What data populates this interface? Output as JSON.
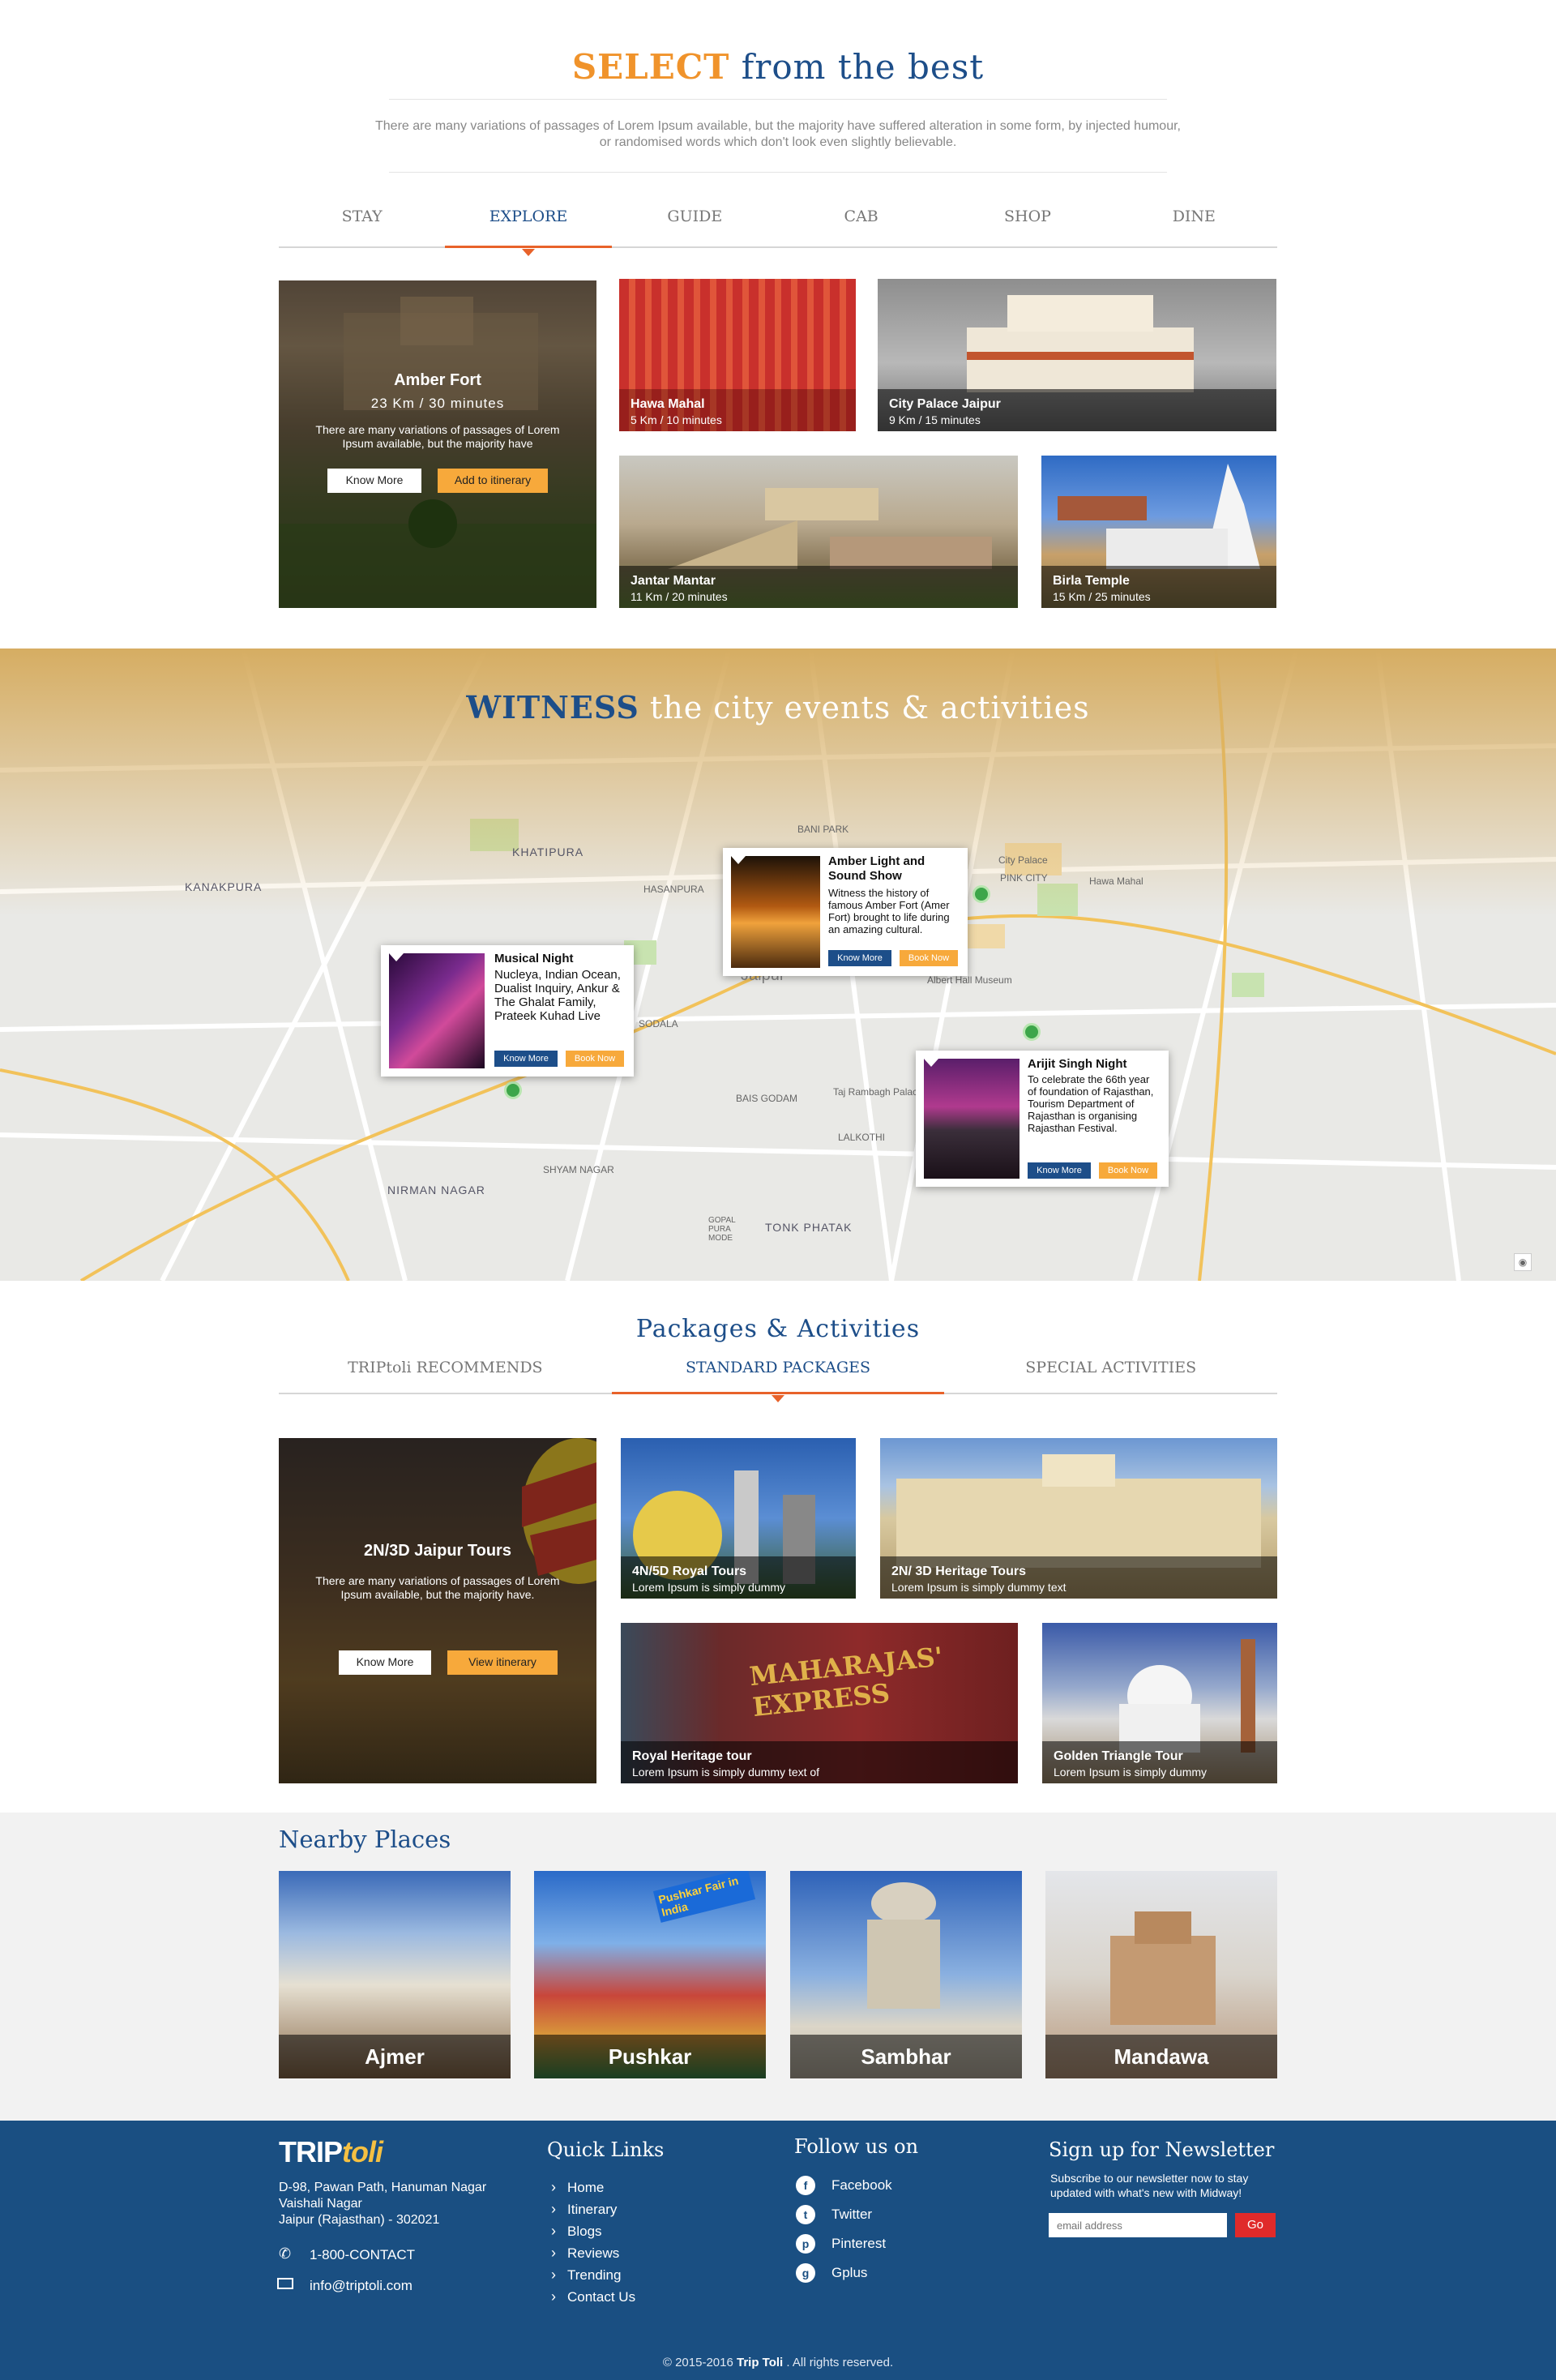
{
  "select": {
    "title_accent": "SELECT",
    "title_rest": " from the best",
    "intro": "There are many variations of passages of Lorem Ipsum available, but the majority have suffered alteration in some form, by injected humour, or randomised words which don't look even slightly believable.",
    "tabs": [
      "STAY",
      "EXPLORE",
      "GUIDE",
      "CAB",
      "SHOP",
      "DINE"
    ],
    "active_tab": "EXPLORE",
    "featured": {
      "title": "Amber Fort",
      "distance": "23 Km /  30 minutes",
      "desc": "There are many variations of passages of Lorem Ipsum available, but the majority have",
      "btn_more": "Know More",
      "btn_add": "Add to itinerary"
    },
    "cards": [
      {
        "title": "Hawa Mahal",
        "sub": "5 Km /  10 minutes"
      },
      {
        "title": "City Palace Jaipur",
        "sub": "9 Km /  15 minutes"
      },
      {
        "title": "Jantar Mantar",
        "sub": "11 Km /  20 minutes"
      },
      {
        "title": "Birla Temple",
        "sub": "15 Km /  25 minutes"
      }
    ]
  },
  "witness": {
    "title_accent": "WITNESS",
    "title_rest": " the city events & activities",
    "map_labels": [
      "KHATIPURA",
      "KANAKPURA",
      "HASANPURA",
      "NIRMAN NAGAR",
      "TONK PHATAK",
      "BANI PARK",
      "PINK CITY",
      "City Palace",
      "Hawa Mahal",
      "Albert Hall Museum",
      "Taj Rambagh Palace",
      "SODALA",
      "BAIS GODAM",
      "LALKOTHI",
      "SHYAM NAGAR",
      "GOPAL PURA MODE",
      "Jaipur"
    ],
    "events": [
      {
        "title": "Amber Light and Sound Show",
        "desc": "Witness the history of famous Amber Fort (Amer Fort) brought to life during an amazing cultural.",
        "btn_more": "Know More",
        "btn_book": "Book Now"
      },
      {
        "title": "Musical Night",
        "desc": "Nucleya, Indian Ocean, Dualist Inquiry, Ankur & The Ghalat Family, Prateek Kuhad Live",
        "btn_more": "Know More",
        "btn_book": "Book Now"
      },
      {
        "title": "Arijit Singh Night",
        "desc": "To celebrate the 66th year of foundation of Rajasthan, Tourism Department of Rajasthan is organising Rajasthan Festival.",
        "btn_more": "Know More",
        "btn_book": "Book Now"
      }
    ]
  },
  "packages": {
    "title": "Packages &  Activities",
    "tabs": [
      "TRIPtoli RECOMMENDS",
      "STANDARD PACKAGES",
      "SPECIAL ACTIVITIES"
    ],
    "active_tab": "STANDARD PACKAGES",
    "featured": {
      "title": "2N/3D Jaipur Tours",
      "desc": "There are many variations of passages of Lorem Ipsum available, but the majority have.",
      "btn_more": "Know More",
      "btn_view": "View itinerary"
    },
    "cards": [
      {
        "title": "4N/5D Royal Tours",
        "sub": "Lorem Ipsum is simply dummy"
      },
      {
        "title": "2N/ 3D Heritage Tours",
        "sub": "Lorem Ipsum is simply dummy text"
      },
      {
        "title": "Royal Heritage tour",
        "sub": "Lorem Ipsum is simply dummy text of"
      },
      {
        "title": "Golden Triangle Tour",
        "sub": "Lorem Ipsum is simply dummy"
      }
    ],
    "train_text": "MAHARAJAS' EXPRESS"
  },
  "nearby": {
    "title": "Nearby Places",
    "places": [
      "Ajmer",
      "Pushkar",
      "Sambhar",
      "Mandawa"
    ],
    "pushkar_banner": "Pushkar Fair in India"
  },
  "footer": {
    "logo_a": "TRIP",
    "logo_b": "toli",
    "address": [
      "D-98, Pawan Path, Hanuman Nagar",
      "Vaishali Nagar",
      "Jaipur (Rajasthan) - 302021"
    ],
    "phone": "1-800-CONTACT",
    "email": "info@triptoli.com",
    "quick_links_title": "Quick Links",
    "quick_links": [
      "Home",
      "Itinerary",
      "Blogs",
      "Reviews",
      "Trending",
      "Contact Us"
    ],
    "follow_title": "Follow us on",
    "social": [
      "Facebook",
      "Twitter",
      "Pinterest",
      "Gplus"
    ],
    "newsletter_title": "Sign up for Newsletter",
    "newsletter_desc": "Subscribe to our newsletter now to stay updated with what's new with Midway!",
    "email_placeholder": "email address",
    "go": "Go",
    "copyright_a": "© 2015-2016 ",
    "copyright_b": "Trip Toli",
    "copyright_c": " . All rights reserved."
  },
  "colors": {
    "accent_orange": "#f0932b",
    "brand_blue": "#1d4e89",
    "tab_underline": "#e8622a",
    "footer_bg": "#1a4f82",
    "button_orange": "#f7a93b",
    "go_red": "#e02a2a"
  }
}
